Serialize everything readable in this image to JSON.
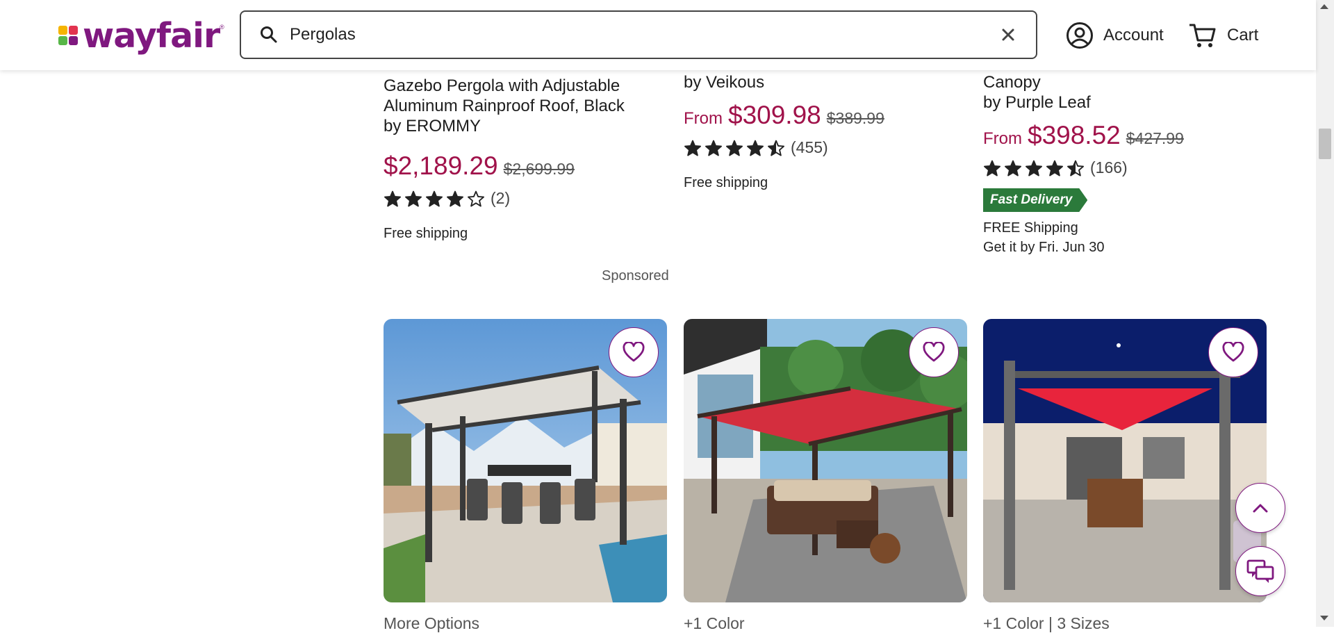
{
  "header": {
    "logo": "wayfair",
    "search_value": "Pergolas",
    "account_label": "Account",
    "cart_label": "Cart"
  },
  "products_top": [
    {
      "title_lines": [
        "Gazebo Pergola with Adjustable",
        "Aluminum Rainproof Roof, Black",
        "by EROMMY"
      ],
      "from": "",
      "price": "$2,189.29",
      "old_price": "$2,699.99",
      "rating": 4,
      "review_count": "(2)",
      "shipping": "Free shipping"
    },
    {
      "title_lines": [
        "by Veikous"
      ],
      "from": "From",
      "price": "$309.98",
      "old_price": "$389.99",
      "rating": 4.5,
      "review_count": "(455)",
      "shipping": "Free shipping"
    },
    {
      "title_lines": [
        "Canopy",
        "by Purple Leaf"
      ],
      "from": "From",
      "price": "$398.52",
      "old_price": "$427.99",
      "rating": 4.5,
      "review_count": "(166)",
      "badge": "Fast Delivery",
      "shipping": "FREE Shipping",
      "delivery": "Get it by Fri. Jun 30"
    }
  ],
  "sponsored_label": "Sponsored",
  "products_cards": [
    {
      "options": "More Options"
    },
    {
      "options": "+1 Color"
    },
    {
      "options": "+1 Color | 3 Sizes"
    }
  ],
  "colors": {
    "brand": "#7f187f",
    "price": "#a0124a",
    "fast_delivery": "#2b7a3b"
  },
  "icons": [
    "search-icon",
    "clear-icon",
    "account-icon",
    "cart-icon",
    "heart-icon",
    "star-icon",
    "chevron-up-icon",
    "chat-icon"
  ]
}
